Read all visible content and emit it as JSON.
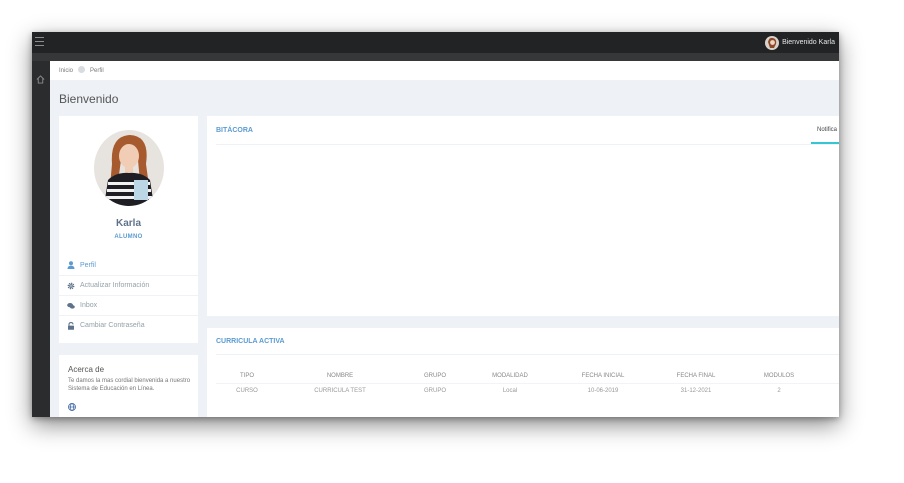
{
  "header": {
    "welcome_text": "Bienvenido Karla"
  },
  "breadcrumb": {
    "items": [
      "Inicio",
      "Perfil"
    ]
  },
  "page": {
    "title": "Bienvenido"
  },
  "profile": {
    "name": "Karla",
    "role": "ALUMNO",
    "links": [
      {
        "label": "Perfil",
        "icon": "user-icon",
        "color": "#5b9bd1"
      },
      {
        "label": "Actualizar Información",
        "icon": "gear-icon",
        "color": "#93a2a9"
      },
      {
        "label": "Inbox",
        "icon": "comments-icon",
        "color": "#93a2a9"
      },
      {
        "label": "Cambiar Contraseña",
        "icon": "lock-icon",
        "color": "#93a2a9"
      }
    ]
  },
  "about": {
    "title": "Acerca de",
    "text": "Te damos la mas cordial bienvenida a nuestro Sistema de Educación en Línea.",
    "icon": "globe-icon"
  },
  "bitacora": {
    "title": "BITÁCORA",
    "tab_label": "Notifica"
  },
  "curricula": {
    "title": "CURRICULA ACTIVA",
    "columns": [
      "TIPO",
      "NOMBRE",
      "GRUPO",
      "MODALIDAD",
      "FECHA INICIAL",
      "FECHA FINAL",
      "MODULOS"
    ],
    "rows": [
      [
        "CURSO",
        "CURRICULA TEST",
        "GRUPO",
        "Local",
        "10-06-2019",
        "31-12-2021",
        "2"
      ]
    ]
  },
  "colors": {
    "accent": "#5b9bd1",
    "tab_underline": "#36c6d3",
    "topbar": "#222325"
  }
}
